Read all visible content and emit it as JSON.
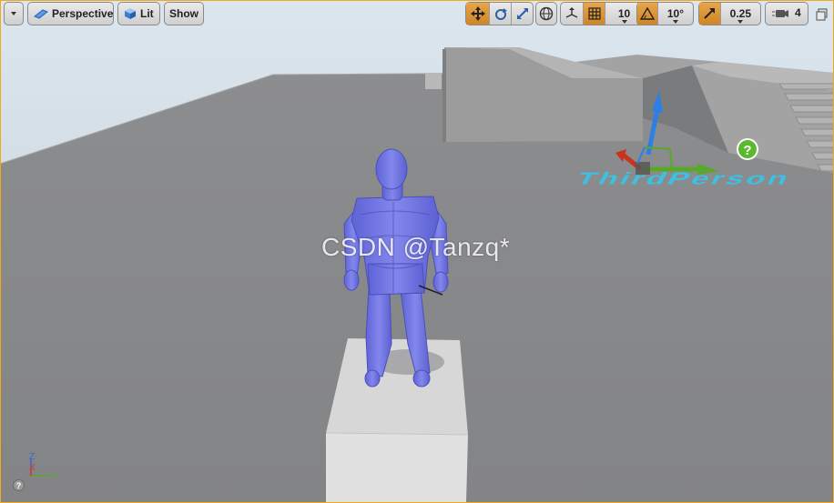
{
  "toolbar": {
    "menu_label": "",
    "perspective_label": "Perspective",
    "lit_label": "Lit",
    "show_label": "Show",
    "grid_snap_value": "10",
    "rotation_snap_value": "10°",
    "scale_snap_value": "0.25",
    "camera_speed_value": "4"
  },
  "viewport": {
    "watermark": "CSDN @Tanzq*",
    "axis_labels": {
      "z": "Z",
      "x": "X",
      "y": "Y"
    },
    "help_glyph": "?"
  },
  "colors": {
    "accent": "#f2a91c",
    "mannequin": "#7479e6",
    "floor": "#8a8b8d",
    "sky": "#dbe6ef",
    "gizmo_x": "#c8321e",
    "gizmo_y": "#58a82a",
    "gizmo_z": "#2d7fe6",
    "player_start_text": "#35c6ec"
  },
  "icons": [
    "dropdown-arrow-icon",
    "perspective-camera-icon",
    "lit-cube-icon",
    "translate-icon",
    "rotate-icon",
    "scale-icon",
    "world-local-icon",
    "surface-snap-icon",
    "grid-snap-icon",
    "rotation-snap-icon",
    "scale-snap-icon",
    "camera-speed-icon",
    "maximize-viewport-icon",
    "help-icon",
    "transform-gizmo-icon"
  ]
}
